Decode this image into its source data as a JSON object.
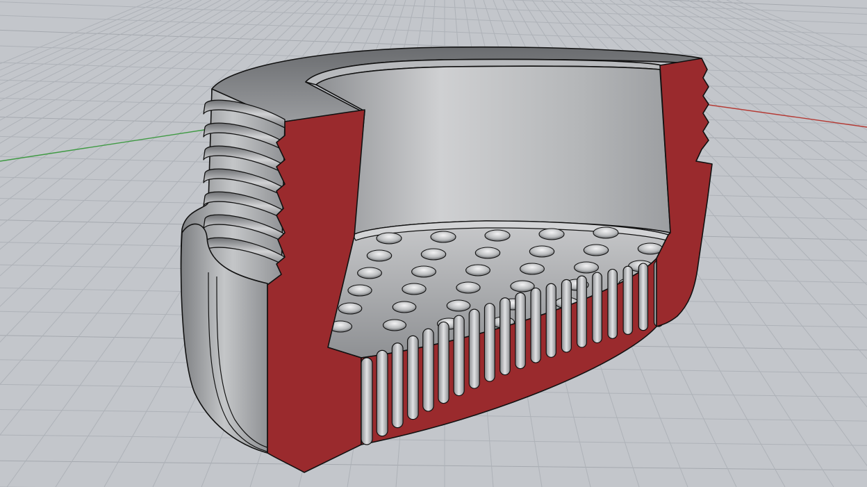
{
  "viewport": {
    "name": "Perspective",
    "background_color": "#c3c6cb",
    "grid": {
      "visible": true,
      "line_color": "#aeb2b8",
      "major_line_color": "#a5a9af"
    },
    "axes": {
      "x_axis_color": "#b53a34",
      "y_axis_color": "#3f9a43"
    }
  },
  "model": {
    "description_icon": "section-cut-threaded-cap",
    "section_color": "#9a2a2d",
    "surface_color": "#a9abae",
    "edge_color": "#111111",
    "perforation_rows": [
      8,
      8,
      7,
      7,
      6,
      4
    ],
    "ridge_count": 20
  }
}
